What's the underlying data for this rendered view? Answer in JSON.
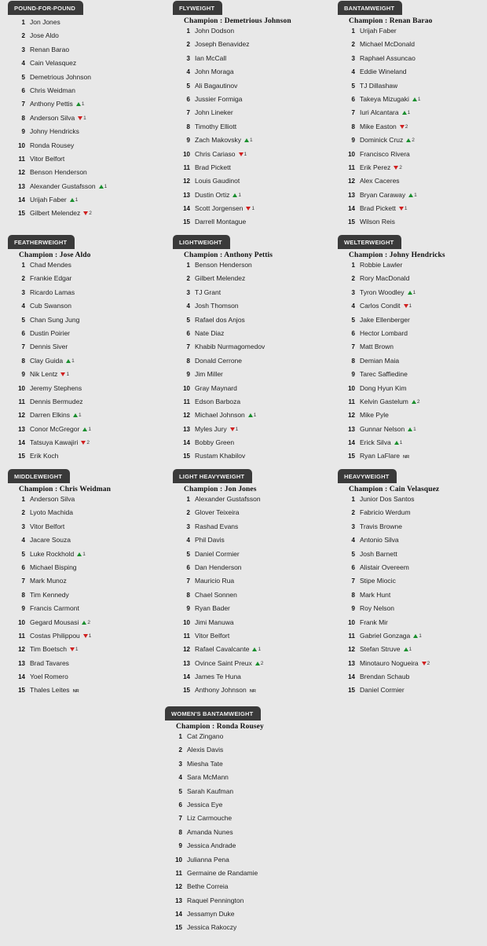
{
  "page": {
    "background_color": "#e8e8e8",
    "tab_color": "#3a3a3a",
    "up_color": "#1a8f2e",
    "down_color": "#d01f1f",
    "champion_prefix": "Champion :",
    "nr_marker": "NR"
  },
  "divisions": [
    {
      "tab_label": "POUND-FOR-POUND",
      "champion": "",
      "fighters": [
        {
          "rank": "1",
          "name": "Jon Jones"
        },
        {
          "rank": "2",
          "name": "Jose Aldo"
        },
        {
          "rank": "3",
          "name": "Renan Barao"
        },
        {
          "rank": "4",
          "name": "Cain Velasquez"
        },
        {
          "rank": "5",
          "name": "Demetrious Johnson"
        },
        {
          "rank": "6",
          "name": "Chris Weidman"
        },
        {
          "rank": "7",
          "name": "Anthony Pettis",
          "move": "up",
          "move_n": "1"
        },
        {
          "rank": "8",
          "name": "Anderson Silva",
          "move": "down",
          "move_n": "1"
        },
        {
          "rank": "9",
          "name": "Johny Hendricks"
        },
        {
          "rank": "10",
          "name": "Ronda Rousey"
        },
        {
          "rank": "11",
          "name": "Vitor Belfort"
        },
        {
          "rank": "12",
          "name": "Benson Henderson"
        },
        {
          "rank": "13",
          "name": "Alexander Gustafsson",
          "move": "up",
          "move_n": "1"
        },
        {
          "rank": "14",
          "name": "Urijah Faber",
          "move": "up",
          "move_n": "1"
        },
        {
          "rank": "15",
          "name": "Gilbert Melendez",
          "move": "down",
          "move_n": "2"
        }
      ]
    },
    {
      "tab_label": "FLYWEIGHT",
      "champion": "Champion : Demetrious Johnson",
      "fighters": [
        {
          "rank": "1",
          "name": "John Dodson"
        },
        {
          "rank": "2",
          "name": "Joseph Benavidez"
        },
        {
          "rank": "3",
          "name": "Ian McCall"
        },
        {
          "rank": "4",
          "name": "John Moraga"
        },
        {
          "rank": "5",
          "name": "Ali Bagautinov"
        },
        {
          "rank": "6",
          "name": "Jussier Formiga"
        },
        {
          "rank": "7",
          "name": "John Lineker"
        },
        {
          "rank": "8",
          "name": "Timothy Elliott"
        },
        {
          "rank": "9",
          "name": "Zach Makovsky",
          "move": "up",
          "move_n": "1"
        },
        {
          "rank": "10",
          "name": "Chris Cariaso",
          "move": "down",
          "move_n": "1"
        },
        {
          "rank": "11",
          "name": "Brad Pickett"
        },
        {
          "rank": "12",
          "name": "Louis Gaudinot"
        },
        {
          "rank": "13",
          "name": "Dustin Ortiz",
          "move": "up",
          "move_n": "1"
        },
        {
          "rank": "14",
          "name": "Scott Jorgensen",
          "move": "down",
          "move_n": "1"
        },
        {
          "rank": "15",
          "name": "Darrell Montague"
        }
      ]
    },
    {
      "tab_label": "BANTAMWEIGHT",
      "champion": "Champion : Renan Barao",
      "fighters": [
        {
          "rank": "1",
          "name": "Urijah Faber"
        },
        {
          "rank": "2",
          "name": "Michael McDonald"
        },
        {
          "rank": "3",
          "name": "Raphael Assuncao"
        },
        {
          "rank": "4",
          "name": "Eddie Wineland"
        },
        {
          "rank": "5",
          "name": "TJ Dillashaw"
        },
        {
          "rank": "6",
          "name": "Takeya Mizugaki",
          "move": "up",
          "move_n": "1"
        },
        {
          "rank": "7",
          "name": "Iuri Alcantara",
          "move": "up",
          "move_n": "1"
        },
        {
          "rank": "8",
          "name": "Mike Easton",
          "move": "down",
          "move_n": "2"
        },
        {
          "rank": "9",
          "name": "Dominick Cruz",
          "move": "up",
          "move_n": "2"
        },
        {
          "rank": "10",
          "name": "Francisco Rivera"
        },
        {
          "rank": "11",
          "name": "Erik Perez",
          "move": "down",
          "move_n": "2"
        },
        {
          "rank": "12",
          "name": "Alex Caceres"
        },
        {
          "rank": "13",
          "name": "Bryan Caraway",
          "move": "up",
          "move_n": "1"
        },
        {
          "rank": "14",
          "name": "Brad Pickett",
          "move": "down",
          "move_n": "1"
        },
        {
          "rank": "15",
          "name": "Wilson Reis"
        }
      ]
    },
    {
      "tab_label": "FEATHERWEIGHT",
      "champion": "Champion : Jose Aldo",
      "fighters": [
        {
          "rank": "1",
          "name": "Chad Mendes"
        },
        {
          "rank": "2",
          "name": "Frankie Edgar"
        },
        {
          "rank": "3",
          "name": "Ricardo Lamas"
        },
        {
          "rank": "4",
          "name": "Cub Swanson"
        },
        {
          "rank": "5",
          "name": "Chan Sung Jung"
        },
        {
          "rank": "6",
          "name": "Dustin Poirier"
        },
        {
          "rank": "7",
          "name": "Dennis Siver"
        },
        {
          "rank": "8",
          "name": "Clay Guida",
          "move": "up",
          "move_n": "1"
        },
        {
          "rank": "9",
          "name": "Nik Lentz",
          "move": "down",
          "move_n": "1"
        },
        {
          "rank": "10",
          "name": "Jeremy Stephens"
        },
        {
          "rank": "11",
          "name": "Dennis Bermudez"
        },
        {
          "rank": "12",
          "name": "Darren Elkins",
          "move": "up",
          "move_n": "1"
        },
        {
          "rank": "13",
          "name": "Conor McGregor",
          "move": "up",
          "move_n": "1"
        },
        {
          "rank": "14",
          "name": "Tatsuya Kawajiri",
          "move": "down",
          "move_n": "2"
        },
        {
          "rank": "15",
          "name": "Erik Koch"
        }
      ]
    },
    {
      "tab_label": "LIGHTWEIGHT",
      "champion": "Champion : Anthony Pettis",
      "fighters": [
        {
          "rank": "1",
          "name": "Benson Henderson"
        },
        {
          "rank": "2",
          "name": "Gilbert Melendez"
        },
        {
          "rank": "3",
          "name": "TJ Grant"
        },
        {
          "rank": "4",
          "name": "Josh Thomson"
        },
        {
          "rank": "5",
          "name": "Rafael dos Anjos"
        },
        {
          "rank": "6",
          "name": "Nate Diaz"
        },
        {
          "rank": "7",
          "name": "Khabib Nurmagomedov"
        },
        {
          "rank": "8",
          "name": "Donald Cerrone"
        },
        {
          "rank": "9",
          "name": "Jim Miller"
        },
        {
          "rank": "10",
          "name": "Gray Maynard"
        },
        {
          "rank": "11",
          "name": "Edson Barboza"
        },
        {
          "rank": "12",
          "name": "Michael Johnson",
          "move": "up",
          "move_n": "1"
        },
        {
          "rank": "13",
          "name": "Myles Jury",
          "move": "down",
          "move_n": "1"
        },
        {
          "rank": "14",
          "name": "Bobby Green"
        },
        {
          "rank": "15",
          "name": "Rustam Khabilov"
        }
      ]
    },
    {
      "tab_label": "WELTERWEIGHT",
      "champion": "Champion : Johny Hendricks",
      "fighters": [
        {
          "rank": "1",
          "name": "Robbie Lawler"
        },
        {
          "rank": "2",
          "name": "Rory MacDonald"
        },
        {
          "rank": "3",
          "name": "Tyron Woodley",
          "move": "up",
          "move_n": "1"
        },
        {
          "rank": "4",
          "name": "Carlos Condit",
          "move": "down",
          "move_n": "1"
        },
        {
          "rank": "5",
          "name": "Jake Ellenberger"
        },
        {
          "rank": "6",
          "name": "Hector Lombard"
        },
        {
          "rank": "7",
          "name": "Matt Brown"
        },
        {
          "rank": "8",
          "name": "Demian Maia"
        },
        {
          "rank": "9",
          "name": "Tarec Saffiedine"
        },
        {
          "rank": "10",
          "name": "Dong Hyun Kim"
        },
        {
          "rank": "11",
          "name": "Kelvin Gastelum",
          "move": "up",
          "move_n": "2"
        },
        {
          "rank": "12",
          "name": "Mike Pyle"
        },
        {
          "rank": "13",
          "name": "Gunnar Nelson",
          "move": "up",
          "move_n": "1"
        },
        {
          "rank": "14",
          "name": "Erick Silva",
          "move": "up",
          "move_n": "1"
        },
        {
          "rank": "15",
          "name": "Ryan LaFlare",
          "nr": "NR"
        }
      ]
    },
    {
      "tab_label": "MIDDLEWEIGHT",
      "champion": "Champion : Chris Weidman",
      "fighters": [
        {
          "rank": "1",
          "name": "Anderson Silva"
        },
        {
          "rank": "2",
          "name": "Lyoto Machida"
        },
        {
          "rank": "3",
          "name": "Vitor Belfort"
        },
        {
          "rank": "4",
          "name": "Jacare Souza"
        },
        {
          "rank": "5",
          "name": "Luke Rockhold",
          "move": "up",
          "move_n": "1"
        },
        {
          "rank": "6",
          "name": "Michael Bisping"
        },
        {
          "rank": "7",
          "name": "Mark Munoz"
        },
        {
          "rank": "8",
          "name": "Tim Kennedy"
        },
        {
          "rank": "9",
          "name": "Francis Carmont"
        },
        {
          "rank": "10",
          "name": "Gegard Mousasi",
          "move": "up",
          "move_n": "2"
        },
        {
          "rank": "11",
          "name": "Costas Philippou",
          "move": "down",
          "move_n": "1"
        },
        {
          "rank": "12",
          "name": "Tim Boetsch",
          "move": "down",
          "move_n": "1"
        },
        {
          "rank": "13",
          "name": "Brad Tavares"
        },
        {
          "rank": "14",
          "name": "Yoel Romero"
        },
        {
          "rank": "15",
          "name": "Thales Leites",
          "nr": "NR"
        }
      ]
    },
    {
      "tab_label": "LIGHT HEAVYWEIGHT",
      "champion": "Champion : Jon Jones",
      "fighters": [
        {
          "rank": "1",
          "name": "Alexander Gustafsson"
        },
        {
          "rank": "2",
          "name": "Glover Teixeira"
        },
        {
          "rank": "3",
          "name": "Rashad Evans"
        },
        {
          "rank": "4",
          "name": "Phil Davis"
        },
        {
          "rank": "5",
          "name": "Daniel Cormier"
        },
        {
          "rank": "6",
          "name": "Dan Henderson"
        },
        {
          "rank": "7",
          "name": "Mauricio Rua"
        },
        {
          "rank": "8",
          "name": "Chael Sonnen"
        },
        {
          "rank": "9",
          "name": "Ryan Bader"
        },
        {
          "rank": "10",
          "name": "Jimi Manuwa"
        },
        {
          "rank": "11",
          "name": "Vitor Belfort"
        },
        {
          "rank": "12",
          "name": "Rafael Cavalcante",
          "move": "up",
          "move_n": "1"
        },
        {
          "rank": "13",
          "name": "Ovince Saint Preux",
          "move": "up",
          "move_n": "2"
        },
        {
          "rank": "14",
          "name": "James Te Huna"
        },
        {
          "rank": "15",
          "name": "Anthony Johnson",
          "nr": "NR"
        }
      ]
    },
    {
      "tab_label": "HEAVYWEIGHT",
      "champion": "Champion : Cain Velasquez",
      "fighters": [
        {
          "rank": "1",
          "name": "Junior Dos Santos"
        },
        {
          "rank": "2",
          "name": "Fabricio Werdum"
        },
        {
          "rank": "3",
          "name": "Travis Browne"
        },
        {
          "rank": "4",
          "name": "Antonio Silva"
        },
        {
          "rank": "5",
          "name": "Josh Barnett"
        },
        {
          "rank": "6",
          "name": "Alistair Overeem"
        },
        {
          "rank": "7",
          "name": "Stipe Miocic"
        },
        {
          "rank": "8",
          "name": "Mark Hunt"
        },
        {
          "rank": "9",
          "name": "Roy Nelson"
        },
        {
          "rank": "10",
          "name": "Frank Mir"
        },
        {
          "rank": "11",
          "name": "Gabriel Gonzaga",
          "move": "up",
          "move_n": "1"
        },
        {
          "rank": "12",
          "name": "Stefan Struve",
          "move": "up",
          "move_n": "1"
        },
        {
          "rank": "13",
          "name": "Minotauro Nogueira",
          "move": "down",
          "move_n": "2"
        },
        {
          "rank": "14",
          "name": "Brendan Schaub"
        },
        {
          "rank": "15",
          "name": "Daniel Cormier"
        }
      ]
    },
    {
      "tab_label": "WOMEN'S BANTAMWEIGHT",
      "champion": "Champion : Ronda Rousey",
      "fighters": [
        {
          "rank": "1",
          "name": "Cat Zingano"
        },
        {
          "rank": "2",
          "name": "Alexis Davis"
        },
        {
          "rank": "3",
          "name": "Miesha Tate"
        },
        {
          "rank": "4",
          "name": "Sara McMann"
        },
        {
          "rank": "5",
          "name": "Sarah Kaufman"
        },
        {
          "rank": "6",
          "name": "Jessica Eye"
        },
        {
          "rank": "7",
          "name": "Liz Carmouche"
        },
        {
          "rank": "8",
          "name": "Amanda Nunes"
        },
        {
          "rank": "9",
          "name": "Jessica Andrade"
        },
        {
          "rank": "10",
          "name": "Julianna Pena"
        },
        {
          "rank": "11",
          "name": "Germaine de Randamie"
        },
        {
          "rank": "12",
          "name": "Bethe Correia"
        },
        {
          "rank": "13",
          "name": "Raquel Pennington"
        },
        {
          "rank": "14",
          "name": "Jessamyn Duke"
        },
        {
          "rank": "15",
          "name": "Jessica Rakoczy"
        }
      ]
    }
  ]
}
